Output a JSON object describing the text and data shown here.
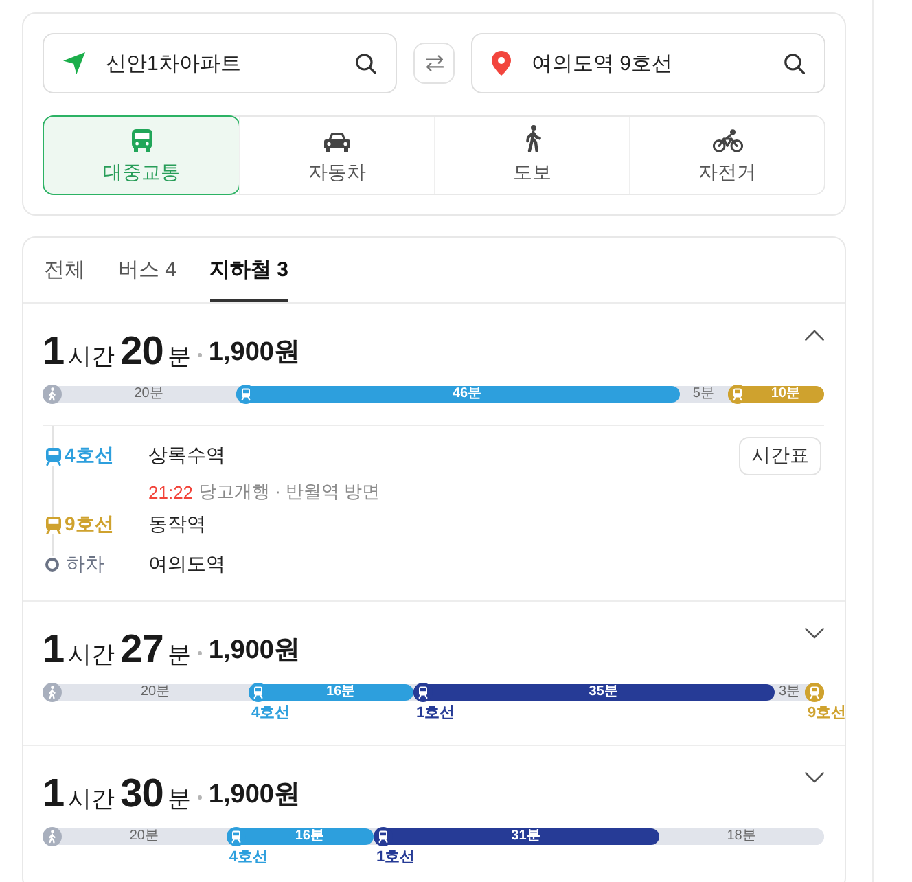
{
  "search": {
    "origin": {
      "value": "신안1차아파트"
    },
    "destination": {
      "value": "여의도역 9호선"
    }
  },
  "modes": [
    {
      "kind": "transit",
      "label": "대중교통",
      "selected": true
    },
    {
      "kind": "car",
      "label": "자동차",
      "selected": false
    },
    {
      "kind": "walk",
      "label": "도보",
      "selected": false
    },
    {
      "kind": "bike",
      "label": "자전거",
      "selected": false
    }
  ],
  "result_tabs": [
    {
      "label": "전체",
      "selected": false
    },
    {
      "label": "버스 4",
      "selected": false
    },
    {
      "label": "지하철 3",
      "selected": true
    }
  ],
  "routes": [
    {
      "hours": "1",
      "hours_unit": "시간",
      "minutes": "20",
      "minutes_unit": "분",
      "fare": "1,900원",
      "expanded": true,
      "segments": [
        {
          "kind": "start",
          "duration": "20분"
        },
        {
          "kind": "ride",
          "color": "#2d9fdd",
          "duration": "46분"
        },
        {
          "kind": "walk",
          "duration": "5분"
        },
        {
          "kind": "ride",
          "color": "#cfa22e",
          "duration": "10분"
        }
      ],
      "stops": [
        {
          "kind": "board",
          "label": "4호선",
          "color": "#2d9fdd",
          "station": "상록수역",
          "button": "시간표",
          "time": "21:22",
          "direction": "당고개행 · 반월역 방면"
        },
        {
          "kind": "board",
          "label": "9호선",
          "color": "#cfa22e",
          "station": "동작역"
        },
        {
          "kind": "alight",
          "label": "하차",
          "station": "여의도역"
        }
      ]
    },
    {
      "hours": "1",
      "hours_unit": "시간",
      "minutes": "27",
      "minutes_unit": "분",
      "fare": "1,900원",
      "expanded": false,
      "segments": [
        {
          "kind": "start",
          "duration": "20분"
        },
        {
          "kind": "ride",
          "color": "#2d9fdd",
          "duration": "16분",
          "line": "4호선"
        },
        {
          "kind": "ride",
          "color": "#263b96",
          "duration": "35분",
          "line": "1호선"
        },
        {
          "kind": "walk",
          "duration": "3분"
        },
        {
          "kind": "ride",
          "color": "#cfa22e",
          "line": "9호선"
        }
      ]
    },
    {
      "hours": "1",
      "hours_unit": "시간",
      "minutes": "30",
      "minutes_unit": "분",
      "fare": "1,900원",
      "expanded": false,
      "segments": [
        {
          "kind": "start",
          "duration": "20분"
        },
        {
          "kind": "ride",
          "color": "#2d9fdd",
          "duration": "16분",
          "line": "4호선"
        },
        {
          "kind": "ride",
          "color": "#263b96",
          "duration": "31분",
          "line": "1호선"
        },
        {
          "kind": "walk",
          "duration": "18분"
        }
      ]
    }
  ]
}
